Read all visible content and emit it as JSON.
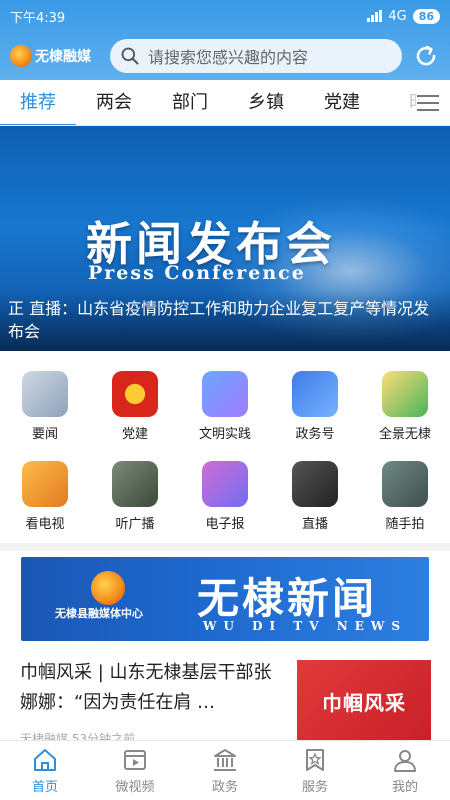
{
  "status_bar": {
    "time": "下午4:39",
    "network": "4G",
    "battery": "86"
  },
  "header": {
    "logo_text": "无棣融媒",
    "search_placeholder": "请搜索您感兴趣的内容",
    "colors": {
      "accent": "#3a9ae6",
      "active_tab": "#2f8fdc"
    }
  },
  "tabs": [
    {
      "label": "推荐",
      "active": true
    },
    {
      "label": "两会"
    },
    {
      "label": "部门"
    },
    {
      "label": "乡镇"
    },
    {
      "label": "党建"
    },
    {
      "label": "时"
    }
  ],
  "banner": {
    "title": "新闻发布会",
    "subtitle": "Press Conference",
    "caption": "正 直播：山东省疫情防控工作和助力企业复工复产等情况发布会"
  },
  "grid": [
    {
      "label": "要闻",
      "icon": "newspaper-icon"
    },
    {
      "label": "党建",
      "icon": "party-emblem-icon"
    },
    {
      "label": "文明实践",
      "icon": "civilization-icon"
    },
    {
      "label": "政务号",
      "icon": "government-desk-icon"
    },
    {
      "label": "全景无棣",
      "icon": "panorama-icon"
    },
    {
      "label": "看电视",
      "icon": "tv-icon"
    },
    {
      "label": "听广播",
      "icon": "radio-icon"
    },
    {
      "label": "电子报",
      "icon": "epaper-icon"
    },
    {
      "label": "直播",
      "icon": "video-camera-icon"
    },
    {
      "label": "随手拍",
      "icon": "camera-icon"
    }
  ],
  "ad_banner": {
    "left_text": "无棣县融媒体中心",
    "title": "无棣新闻",
    "subtitle": "WU DI TV NEWS"
  },
  "article": {
    "title": "巾帼风采 | 山东无棣基层干部张娜娜：“因为责任在肩 …",
    "meta": "无棣融媒  53分钟之前",
    "thumb_text": "巾帼风采"
  },
  "bottom_nav": [
    {
      "label": "首页",
      "icon": "home-icon",
      "active": true
    },
    {
      "label": "微视频",
      "icon": "video-icon"
    },
    {
      "label": "政务",
      "icon": "government-building-icon"
    },
    {
      "label": "服务",
      "icon": "service-bookmark-icon"
    },
    {
      "label": "我的",
      "icon": "profile-icon"
    }
  ]
}
